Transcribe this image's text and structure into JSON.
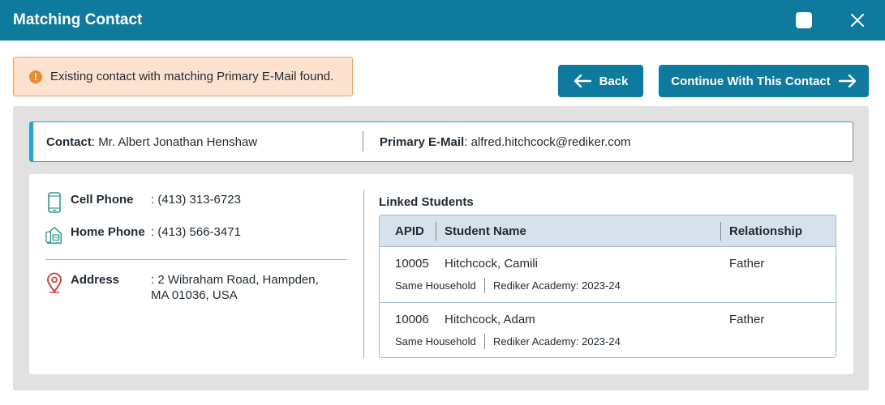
{
  "window": {
    "title": "Matching Contact",
    "maximize_icon": "square-icon",
    "close_icon": "close-icon"
  },
  "alert": {
    "icon": "warning-icon",
    "text": "Existing contact with matching Primary E-Mail found.",
    "color": "#ec8a2e"
  },
  "actions": {
    "back_label": "Back",
    "continue_label": "Continue With This Contact"
  },
  "contact_bar": {
    "contact_label": "Contact",
    "contact_value": "Mr. Albert Jonathan Henshaw",
    "email_label": "Primary E-Mail",
    "email_value": "alfred.hitchcock@rediker.com"
  },
  "details": {
    "cell_phone": {
      "label": "Cell Phone",
      "value": ": (413) 313-6723",
      "icon": "mobile-phone-icon"
    },
    "home_phone": {
      "label": "Home Phone",
      "value": ": (413) 566-3471",
      "icon": "home-phone-icon"
    },
    "address": {
      "label": "Address",
      "value": ": 2 Wibraham Road, Hampden, MA 01036, USA",
      "icon": "location-pin-icon"
    }
  },
  "linked_students": {
    "title": "Linked Students",
    "columns": {
      "apid": "APID",
      "name": "Student Name",
      "relationship": "Relationship"
    },
    "rows": [
      {
        "apid": "10005",
        "name": "Hitchcock, Camili",
        "relationship": "Father",
        "household": "Same Household",
        "school": "Rediker Academy: 2023-24"
      },
      {
        "apid": "10006",
        "name": "Hitchcock, Adam",
        "relationship": "Father",
        "household": "Same Household",
        "school": "Rediker Academy: 2023-24"
      }
    ]
  },
  "colors": {
    "brand": "#0d7a9e",
    "accent_border": "#2f9ed0",
    "alert_bg": "#fde3cf",
    "table_header_bg": "#d6e1ec",
    "pin": "#e0312f"
  }
}
